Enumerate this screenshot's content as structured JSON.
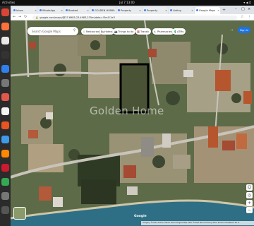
{
  "os": {
    "activities": "Activities",
    "clock": "Jul 7 13:00",
    "system_icons": "▾ ◀ ⏻"
  },
  "dock": {
    "apps": [
      {
        "name": "chrome-icon",
        "color": "#db4437"
      },
      {
        "name": "firefox-icon",
        "color": "#ff7139"
      },
      {
        "name": "files-icon",
        "color": "#e8e8e8"
      },
      {
        "name": "terminal-icon",
        "color": "#333333"
      },
      {
        "name": "vscode-icon",
        "color": "#2f80ed"
      },
      {
        "name": "settings-icon",
        "color": "#777777"
      },
      {
        "name": "pdf-icon",
        "color": "#e2574c"
      },
      {
        "name": "text-editor-icon",
        "color": "#f4f4f4"
      },
      {
        "name": "store-icon",
        "color": "#e95420"
      },
      {
        "name": "help-icon",
        "color": "#3d9be9"
      },
      {
        "name": "vlc-icon",
        "color": "#ff8800"
      },
      {
        "name": "opera-icon",
        "color": "#cc1b2e"
      },
      {
        "name": "maps-icon",
        "color": "#34a853"
      },
      {
        "name": "trash-icon",
        "color": "#777777"
      },
      {
        "name": "apps-grid-icon",
        "color": "#555555"
      }
    ]
  },
  "browser": {
    "tabs": [
      {
        "title": "Inbox",
        "active": false
      },
      {
        "title": "WhatsApp",
        "active": false
      },
      {
        "title": "Booked",
        "active": false
      },
      {
        "title": "GOLDEN HOME",
        "active": false
      },
      {
        "title": "Property",
        "active": false
      },
      {
        "title": "Property",
        "active": false
      },
      {
        "title": "Listing",
        "active": false
      },
      {
        "title": "Google Maps",
        "active": true
      }
    ],
    "new_tab": "+",
    "window_controls": [
      "–",
      "□",
      "×"
    ],
    "url": "google.com/maps/@37.6985,23.4983,235m/data=!3m1!1e3",
    "lock_icon": "🔒"
  },
  "map": {
    "search_placeholder": "Search Google Maps",
    "chips": [
      {
        "icon": "🍴",
        "label": "Restaurants"
      },
      {
        "icon": "🛏",
        "label": "Hotels"
      },
      {
        "icon": "📷",
        "label": "Things to do"
      },
      {
        "icon": "⛽",
        "label": "Transit"
      },
      {
        "icon": "♿",
        "label": "Pharmacies"
      },
      {
        "icon": "💲",
        "label": "ATMs"
      }
    ],
    "signin_label": "Sign in",
    "apps_icon": "∷",
    "watermark": "Golden Home",
    "google_logo": "Google",
    "attribution": "Imagery ©2024 Airbus, Maxar Technologies  Map data ©2024  Terms  Privacy  Send Product Feedback  20 m",
    "zoom_in": "+",
    "zoom_out": "−",
    "locate": "◎",
    "pegman": "☺",
    "colors": {
      "vegetation": "#5e6b48",
      "soil": "#a89f84",
      "road": "#bfbcb3",
      "sea": "#2f6f86",
      "plot_outline": "#000000"
    }
  }
}
